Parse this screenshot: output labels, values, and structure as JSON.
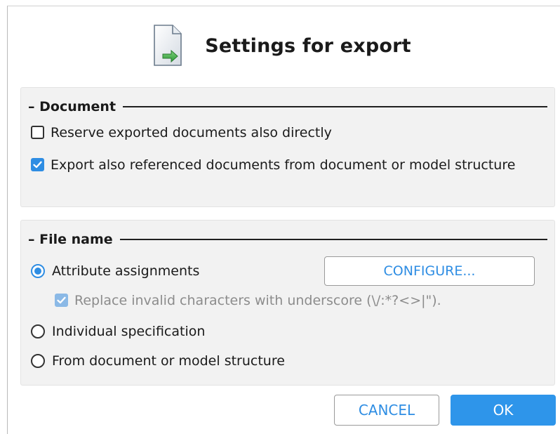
{
  "dialog": {
    "title": "Settings for export",
    "icon": "export-document-icon"
  },
  "document_section": {
    "legend": "– Document",
    "options": [
      {
        "label": "Reserve exported documents also directly",
        "checked": false
      },
      {
        "label": "Export also referenced documents from document or model structure",
        "checked": true
      }
    ]
  },
  "file_name_section": {
    "legend": "– File name",
    "radios": [
      {
        "label": "Attribute assignments",
        "selected": true
      },
      {
        "label": "Individual specification",
        "selected": false
      },
      {
        "label": "From document or model structure",
        "selected": false
      }
    ],
    "sub_option": {
      "label": "Replace invalid characters with underscore (\\/:*?<>|\").",
      "checked": true,
      "disabled": true
    },
    "configure_label": "CONFIGURE..."
  },
  "footer": {
    "cancel_label": "CANCEL",
    "ok_label": "OK"
  },
  "colors": {
    "accent": "#2e8de3",
    "panel_bg": "#f2f2f2",
    "ok_bg": "#2e95ea"
  }
}
